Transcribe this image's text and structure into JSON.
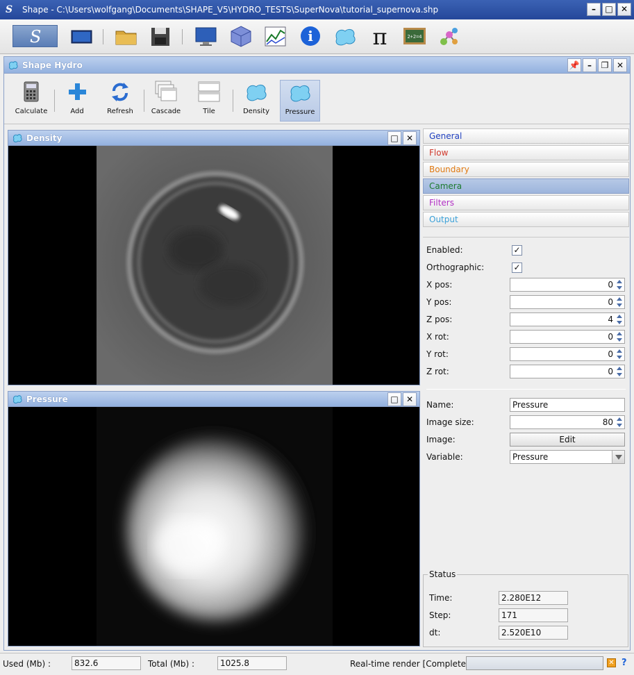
{
  "window": {
    "title": "Shape - C:\\Users\\wolfgang\\Documents\\SHAPE_V5\\HYDRO_TESTS\\SuperNova\\tutorial_supernova.shp"
  },
  "main_toolbar": {
    "icons": [
      "shape-logo-icon",
      "render-window-icon",
      "open-folder-icon",
      "save-disk-icon",
      "monitor-icon",
      "cube-icon",
      "plot-icon",
      "info-icon",
      "hydro-splash-icon",
      "pi-icon",
      "chalkboard-icon",
      "molecule-icon"
    ]
  },
  "hydro_frame": {
    "title": "Shape Hydro",
    "toolbar": {
      "calculate": "Calculate",
      "add": "Add",
      "refresh": "Refresh",
      "cascade": "Cascade",
      "tile": "Tile",
      "density": "Density",
      "pressure": "Pressure"
    }
  },
  "density_frame": {
    "title": "Density"
  },
  "pressure_frame": {
    "title": "Pressure"
  },
  "tabs": [
    {
      "label": "General",
      "color": "#1f3fbf"
    },
    {
      "label": "Flow",
      "color": "#d0392b"
    },
    {
      "label": "Boundary",
      "color": "#e07a12"
    },
    {
      "label": "Camera",
      "color": "#1d7a2e"
    },
    {
      "label": "Filters",
      "color": "#b12fc4"
    },
    {
      "label": "Output",
      "color": "#3aa0d8"
    }
  ],
  "camera": {
    "enabled_label": "Enabled:",
    "enabled_check": "✓",
    "ortho_label": "Orthographic:",
    "ortho_check": "✓",
    "xpos_label": "X pos:",
    "xpos": "0",
    "ypos_label": "Y pos:",
    "ypos": "0",
    "zpos_label": "Z pos:",
    "zpos": "4",
    "xrot_label": "X rot:",
    "xrot": "0",
    "yrot_label": "Y rot:",
    "yrot": "0",
    "zrot_label": "Z rot:",
    "zrot": "0"
  },
  "output": {
    "name_label": "Name:",
    "name": "Pressure",
    "imagesize_label": "Image size:",
    "imagesize": "80",
    "image_label": "Image:",
    "edit_button": "Edit",
    "variable_label": "Variable:",
    "variable": "Pressure"
  },
  "status": {
    "legend": "Status",
    "time_label": "Time:",
    "time": "2.280E12",
    "step_label": "Step:",
    "step": "171",
    "dt_label": "dt:",
    "dt": "2.520E10"
  },
  "statusbar": {
    "used_label": "Used (Mb) :",
    "used": "832.6",
    "total_label": "Total (Mb) :",
    "total": "1025.8",
    "render_label": "Real-time render [Complete]",
    "help": "?"
  }
}
